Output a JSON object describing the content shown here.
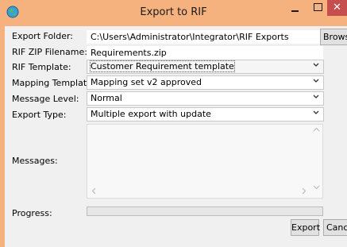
{
  "window": {
    "title": "Export to RIF",
    "close_glyph": "✕"
  },
  "form": {
    "export_folder": {
      "label": "Export Folder:",
      "value": "C:\\Users\\Administrator\\Integrator\\RIF Exports",
      "browse_label": "Browse"
    },
    "zip_filename": {
      "label": "RIF ZIP Filename:",
      "value": "Requirements.zip"
    },
    "rif_template": {
      "label": "RIF Template:",
      "value": "Customer Requirement template"
    },
    "mapping_template": {
      "label": "Mapping Template:",
      "value": "Mapping set v2 approved"
    },
    "message_level": {
      "label": "Message Level:",
      "value": "Normal"
    },
    "export_type": {
      "label": "Export Type:",
      "value": "Multiple export with update"
    },
    "messages": {
      "label": "Messages:",
      "content": ""
    },
    "progress": {
      "label": "Progress:",
      "percent": 0
    }
  },
  "buttons": {
    "export": "Export",
    "cancel": "Cancel"
  },
  "colors": {
    "titlebar": "#f5b27f",
    "close": "#c74e4e",
    "progress_fill": "#06b025"
  },
  "icons": {
    "app": "globe-icon",
    "chevron": "chevron-down-icon"
  }
}
